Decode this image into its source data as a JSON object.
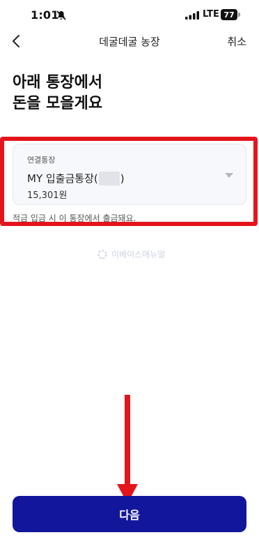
{
  "status_bar": {
    "time": "1:01",
    "network": "LTE",
    "battery": "77"
  },
  "nav": {
    "title": "데굴데굴 농장",
    "cancel_label": "취소"
  },
  "headline": {
    "line1": "아래 통장에서",
    "line2": "돈을 모을게요"
  },
  "account": {
    "label": "연결통장",
    "name_prefix": "MY 입출금통장(",
    "name_suffix": ")",
    "balance": "15,301원"
  },
  "notice": "적금 입금 시 이 통장에서 출금돼요.",
  "watermark": "이베이스매뉴얼",
  "next_button": "다음",
  "colors": {
    "primary": "#12169a",
    "highlight": "#e4141c"
  }
}
